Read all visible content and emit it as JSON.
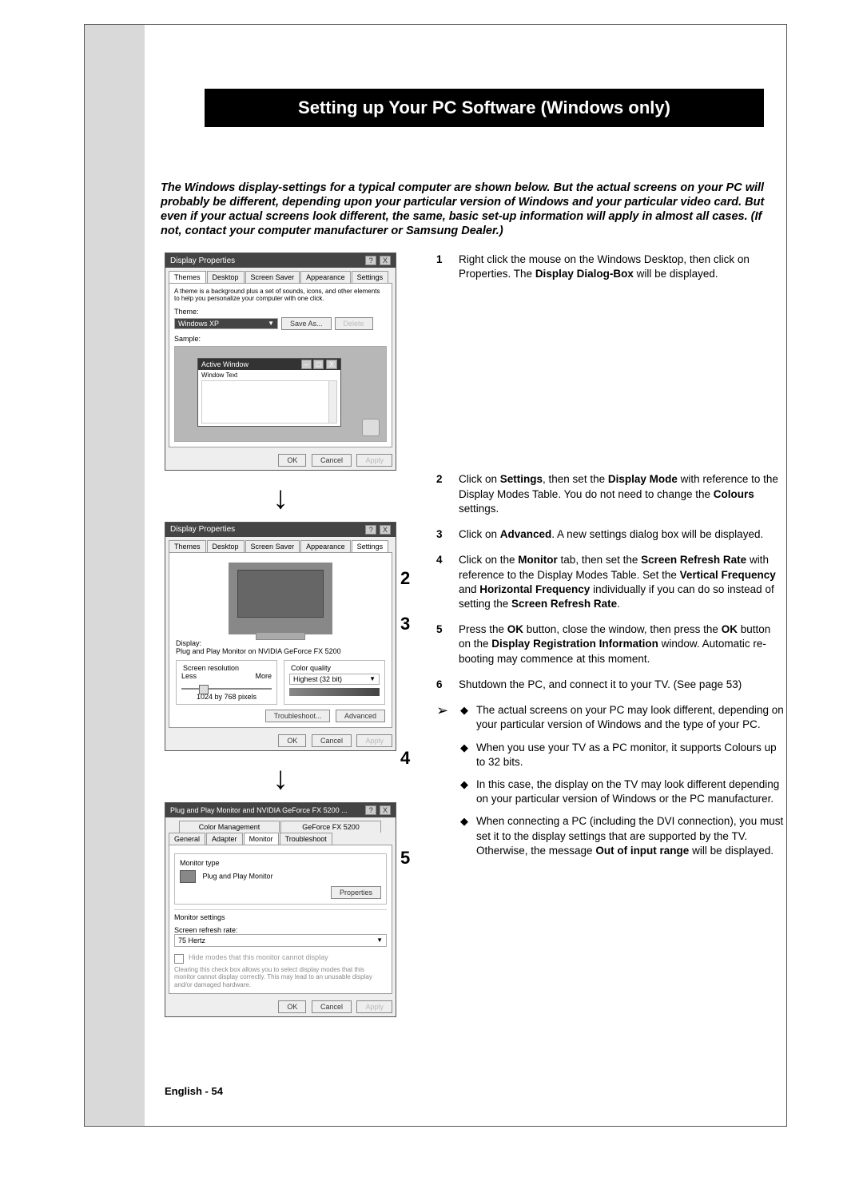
{
  "title": "Setting up Your PC Software (Windows only)",
  "intro": "The Windows display-settings for a typical computer are shown below. But the actual screens on your PC will probably be different, depending upon your particular version of Windows and your particular video card. But even if your actual screens look different, the same, basic set-up information will apply in almost all cases. (If not, contact your computer manufacturer or Samsung Dealer.)",
  "dialog1": {
    "title": "Display Properties",
    "help_icon": "?",
    "close_icon": "X",
    "tabs": [
      "Themes",
      "Desktop",
      "Screen Saver",
      "Appearance",
      "Settings"
    ],
    "active_tab": 0,
    "theme_desc": "A theme is a background plus a set of sounds, icons, and other elements to help you personalize your computer with one click.",
    "theme_label": "Theme:",
    "theme_value": "Windows XP",
    "save_as": "Save As...",
    "delete": "Delete",
    "sample_label": "Sample:",
    "active_window_title": "Active Window",
    "window_text": "Window Text",
    "min_icon": "–",
    "max_icon": "□",
    "ok": "OK",
    "cancel": "Cancel",
    "apply": "Apply"
  },
  "dialog2": {
    "title": "Display Properties",
    "help_icon": "?",
    "close_icon": "X",
    "tabs": [
      "Themes",
      "Desktop",
      "Screen Saver",
      "Appearance",
      "Settings"
    ],
    "active_tab": 4,
    "display_label": "Display:",
    "display_name": "Plug and Play Monitor on NVIDIA GeForce FX 5200",
    "sr_title": "Screen resolution",
    "sr_less": "Less",
    "sr_more": "More",
    "sr_value": "1024 by 768 pixels",
    "cq_title": "Color quality",
    "cq_value": "Highest (32 bit)",
    "troubleshoot": "Troubleshoot...",
    "advanced": "Advanced",
    "ok": "OK",
    "cancel": "Cancel",
    "apply": "Apply"
  },
  "dialog3": {
    "title": "Plug and Play Monitor and NVIDIA GeForce FX 5200 ...",
    "help_icon": "?",
    "close_icon": "X",
    "tabs_top": [
      "Color Management",
      "GeForce FX 5200"
    ],
    "tabs_bottom": [
      "General",
      "Adapter",
      "Monitor",
      "Troubleshoot"
    ],
    "active_tab_bottom": 2,
    "monitor_type_title": "Monitor type",
    "monitor_type_name": "Plug and Play Monitor",
    "properties": "Properties",
    "monitor_settings_title": "Monitor settings",
    "refresh_label": "Screen refresh rate:",
    "refresh_value": "75 Hertz",
    "hide_modes_label": "Hide modes that this monitor cannot display",
    "hide_modes_help": "Clearing this check box allows you to select display modes that this monitor cannot display correctly. This may lead to an unusable display and/or damaged hardware.",
    "ok": "OK",
    "cancel": "Cancel",
    "apply": "Apply"
  },
  "callouts": {
    "c2": "2",
    "c3": "3",
    "c4": "4",
    "c5": "5"
  },
  "steps": {
    "s1_num": "1",
    "s1_a": "Right click the mouse on the Windows Desktop, then click on Properties. The ",
    "s1_b": "Display Dialog-Box",
    "s1_c": " will be displayed.",
    "s2_num": "2",
    "s2_a": "Click on ",
    "s2_b": "Settings",
    "s2_c": ", then set the ",
    "s2_d": "Display Mode",
    "s2_e": " with reference to the Display Modes Table. You do not need to change the ",
    "s2_f": "Colours",
    "s2_g": " settings.",
    "s3_num": "3",
    "s3_a": "Click on ",
    "s3_b": "Advanced",
    "s3_c": ". A new settings dialog box will be displayed.",
    "s4_num": "4",
    "s4_a": "Click on the ",
    "s4_b": "Monitor",
    "s4_c": " tab, then set the ",
    "s4_d": "Screen Refresh Rate",
    "s4_e": " with reference to the Display Modes Table. Set the ",
    "s4_f": "Vertical Frequency",
    "s4_g": " and ",
    "s4_h": "Horizontal Frequency",
    "s4_i": " individually if you can do so instead of setting the ",
    "s4_j": "Screen Refresh Rate",
    "s4_k": ".",
    "s5_num": "5",
    "s5_a": "Press the ",
    "s5_b": "OK",
    "s5_c": " button, close the window, then press the ",
    "s5_d": "OK",
    "s5_e": " button on the ",
    "s5_f": "Display Registration Information",
    "s5_g": " window. Automatic re-booting may commence at this moment.",
    "s6_num": "6",
    "s6_a": "Shutdown the PC, and connect it to your TV. (See page 53)"
  },
  "notes": {
    "b1": "The actual screens on your PC may look different, depending on your particular version of Windows and the type of your PC.",
    "b2": "When you use your TV as a PC monitor, it supports Colours up to 32 bits.",
    "b3": "In this case, the display on the TV may look different depending on your particular version of Windows or the PC manufacturer.",
    "b4_a": "When connecting a PC (including the DVI connection), you must set it to the display settings that are supported by the TV. Otherwise, the message ",
    "b4_b": "Out of input range",
    "b4_c": " will be displayed."
  },
  "footer": {
    "lang": "English - ",
    "page": "54"
  },
  "glyphs": {
    "arrow_down": "↓",
    "diamond": "◆",
    "note_arrow": "➢",
    "caret_down": "▼"
  }
}
